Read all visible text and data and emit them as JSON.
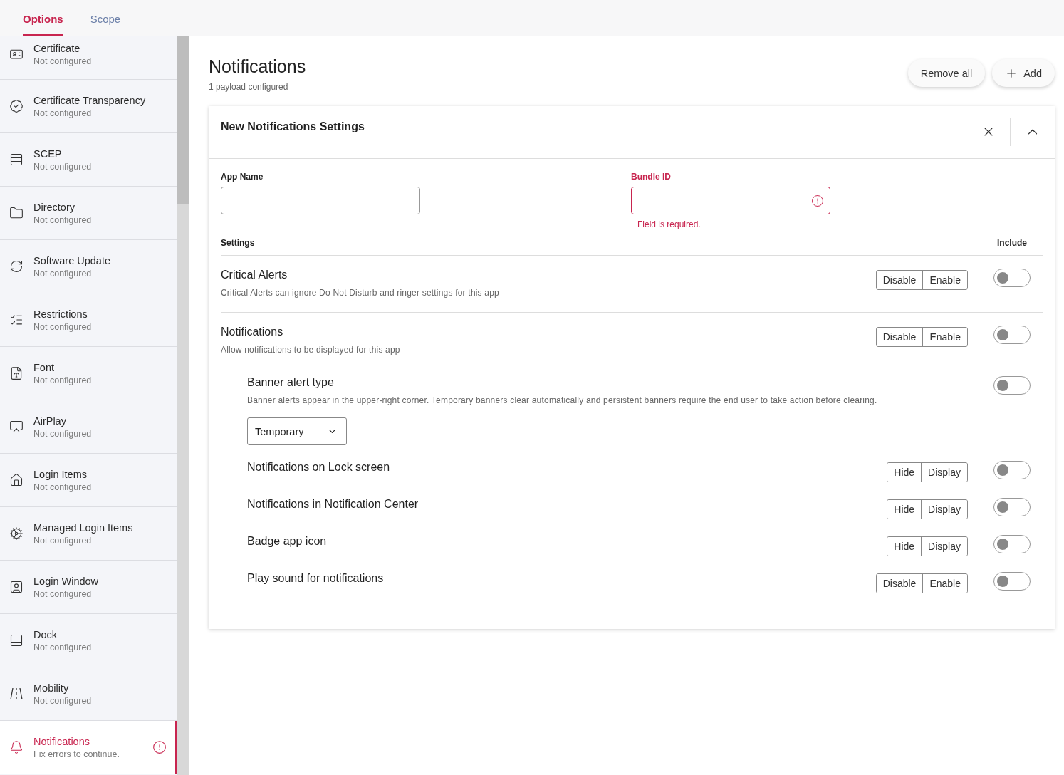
{
  "tabs": [
    {
      "label": "Options",
      "selected": true
    },
    {
      "label": "Scope",
      "selected": false
    }
  ],
  "sidebar": {
    "items": [
      {
        "title": "Certificate",
        "status": "Not configured",
        "selected": false,
        "error": false
      },
      {
        "title": "Certificate Transparency",
        "status": "Not configured",
        "selected": false,
        "error": false
      },
      {
        "title": "SCEP",
        "status": "Not configured",
        "selected": false,
        "error": false
      },
      {
        "title": "Directory",
        "status": "Not configured",
        "selected": false,
        "error": false
      },
      {
        "title": "Software Update",
        "status": "Not configured",
        "selected": false,
        "error": false
      },
      {
        "title": "Restrictions",
        "status": "Not configured",
        "selected": false,
        "error": false
      },
      {
        "title": "Font",
        "status": "Not configured",
        "selected": false,
        "error": false
      },
      {
        "title": "AirPlay",
        "status": "Not configured",
        "selected": false,
        "error": false
      },
      {
        "title": "Login Items",
        "status": "Not configured",
        "selected": false,
        "error": false
      },
      {
        "title": "Managed Login Items",
        "status": "Not configured",
        "selected": false,
        "error": false
      },
      {
        "title": "Login Window",
        "status": "Not configured",
        "selected": false,
        "error": false
      },
      {
        "title": "Dock",
        "status": "Not configured",
        "selected": false,
        "error": false
      },
      {
        "title": "Mobility",
        "status": "Not configured",
        "selected": false,
        "error": false
      },
      {
        "title": "Notifications",
        "status": "Fix errors to continue.",
        "selected": true,
        "error": true
      }
    ]
  },
  "page": {
    "title": "Notifications",
    "subtitle": "1 payload configured",
    "buttons": [
      {
        "label": "Remove all",
        "kind": "plain"
      },
      {
        "label": "Add",
        "kind": "add"
      }
    ]
  },
  "card": {
    "title": "New Notifications Settings",
    "expanded": true,
    "fields": [
      {
        "label": "App Name",
        "error": false
      },
      {
        "label": "Bundle ID",
        "error": true,
        "error_text": "Field is required."
      }
    ],
    "settings_header": "Settings",
    "include_header": "Include",
    "settings": [
      {
        "kind": "segmented",
        "title": "Critical Alerts",
        "description": "Critical Alerts can ignore Do Not Disturb and ringer settings for this app",
        "options": [
          "Disable",
          "Enable"
        ],
        "on": false
      },
      {
        "kind": "segmented",
        "title": "Notifications",
        "description": "Allow notifications to be displayed for this app",
        "options": [
          "Disable",
          "Enable"
        ],
        "on": false,
        "children": [
          {
            "kind": "select",
            "title": "Banner alert type",
            "description": "Banner alerts appear in the upper-right corner. Temporary banners clear automatically and persistent banners require the end user to take action before clearing.",
            "value": "Temporary",
            "on": false
          },
          {
            "kind": "segmented",
            "title": "Notifications on Lock screen",
            "options": [
              "Hide",
              "Display"
            ],
            "on": false
          },
          {
            "kind": "segmented",
            "title": "Notifications in Notification Center",
            "options": [
              "Hide",
              "Display"
            ],
            "on": false
          },
          {
            "kind": "segmented",
            "title": "Badge app icon",
            "options": [
              "Hide",
              "Display"
            ],
            "on": false
          },
          {
            "kind": "segmented",
            "title": "Play sound for notifications",
            "options": [
              "Disable",
              "Enable"
            ],
            "on": false
          }
        ]
      }
    ]
  }
}
